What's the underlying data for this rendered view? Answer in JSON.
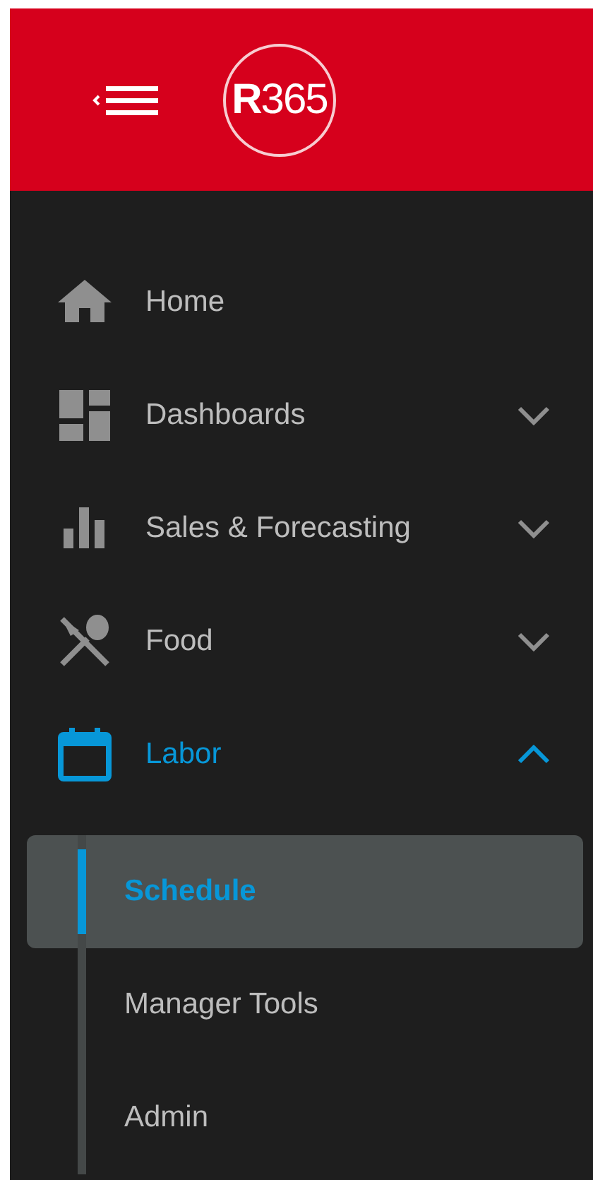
{
  "header": {
    "logo": "**R**365"
  },
  "nav": [
    {
      "label": "Home",
      "kind": "link",
      "active": false
    },
    {
      "label": "Dashboards",
      "kind": "group",
      "active": false,
      "expanded": false
    },
    {
      "label": "Sales & Forecasting",
      "kind": "group",
      "active": false,
      "expanded": false
    },
    {
      "label": "Food",
      "kind": "group",
      "active": false,
      "expanded": false
    },
    {
      "label": "Labor",
      "kind": "group",
      "active": true,
      "expanded": true,
      "children": [
        {
          "label": "Schedule",
          "selected": true
        },
        {
          "label": "Manager Tools",
          "selected": false
        },
        {
          "label": "Admin",
          "selected": false
        }
      ]
    }
  ]
}
